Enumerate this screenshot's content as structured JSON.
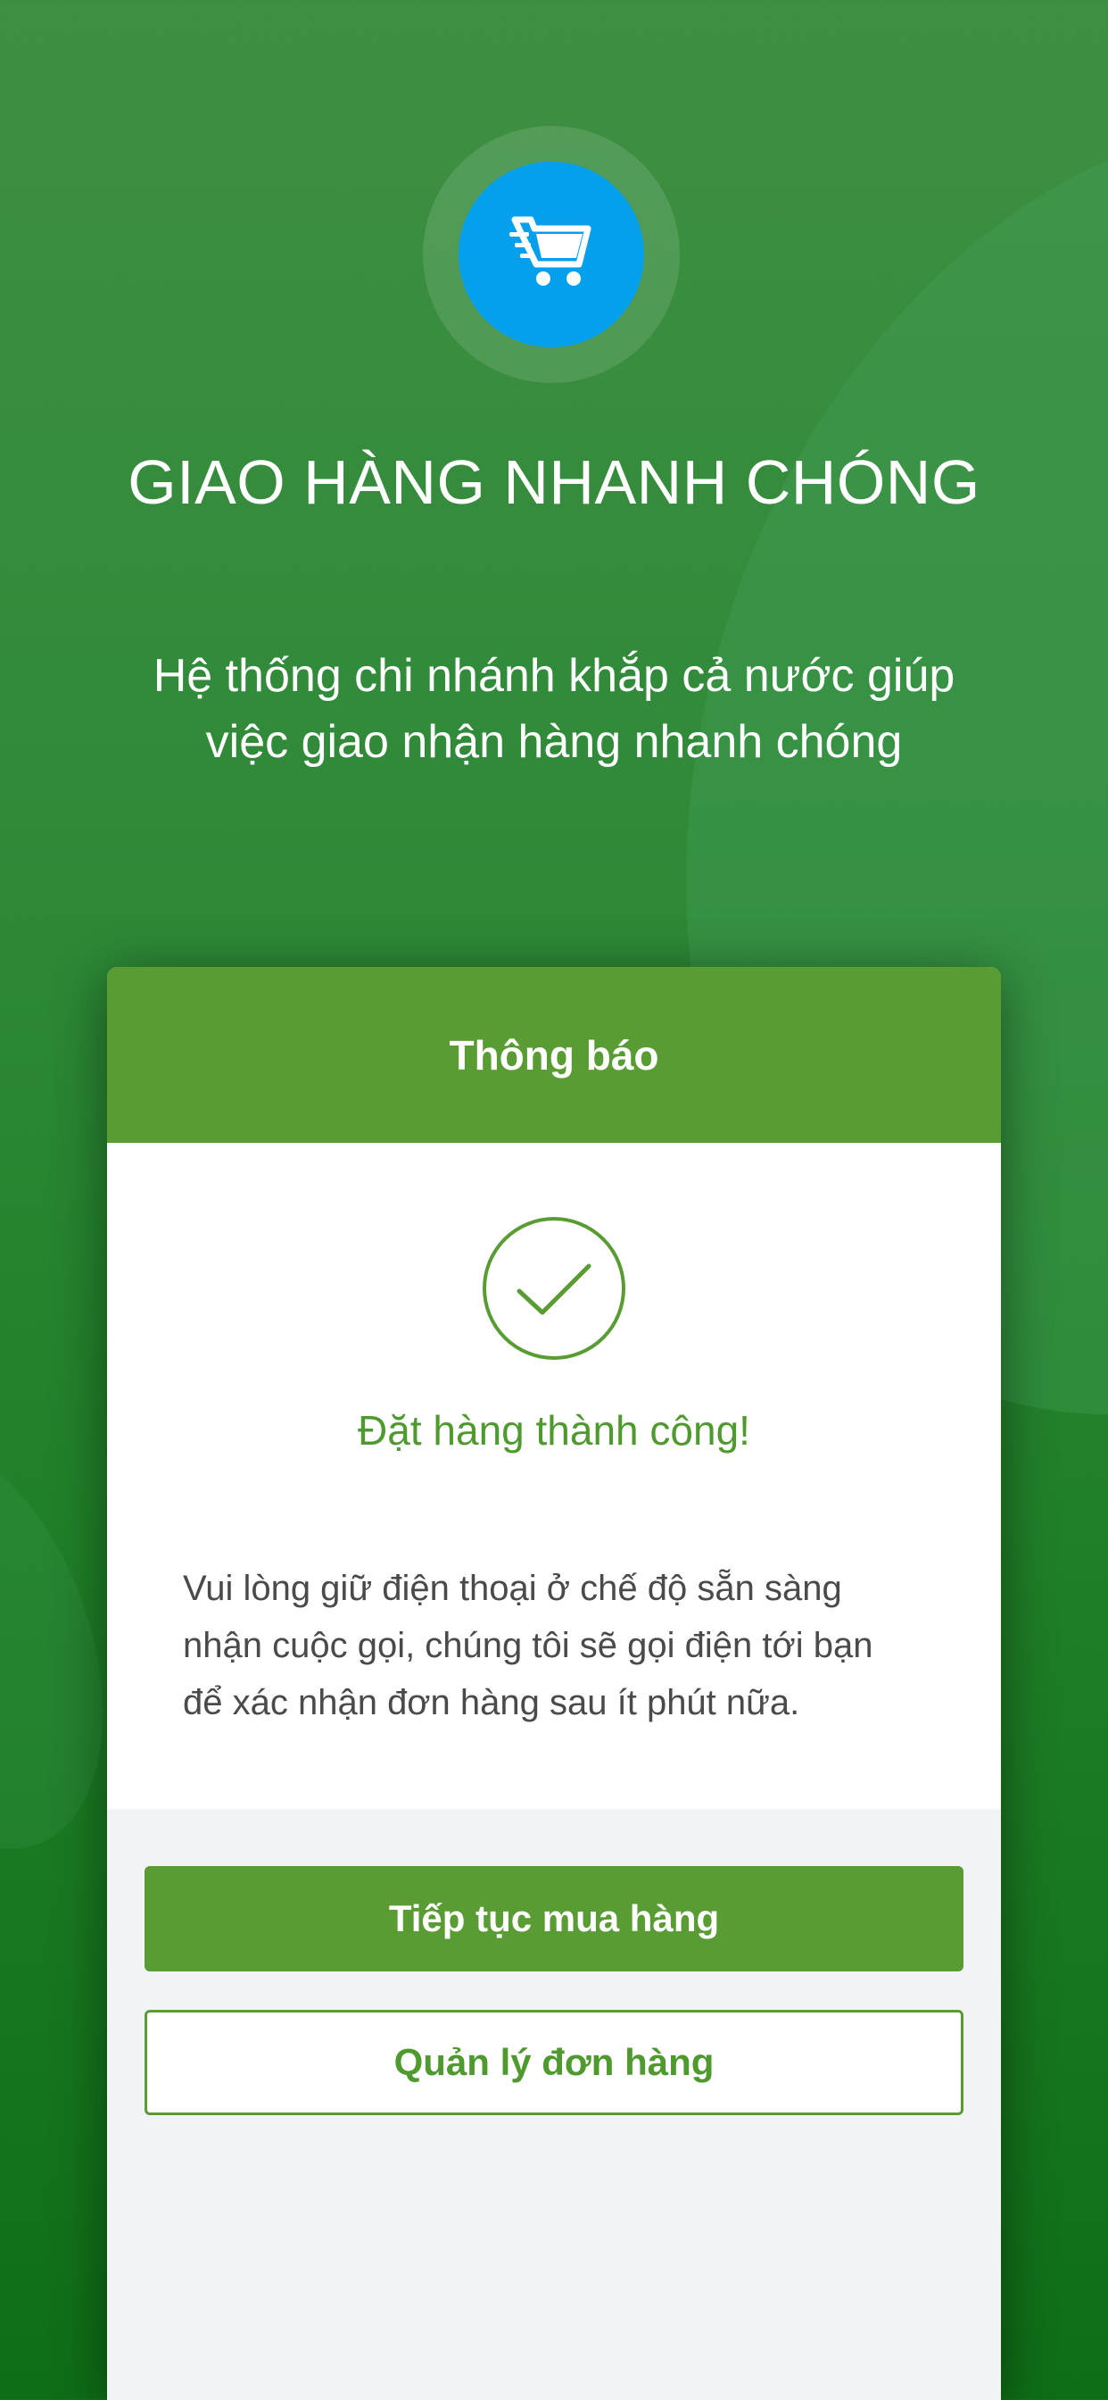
{
  "hero": {
    "icon": "shopping-cart-icon",
    "title": "GIAO HÀNG NHANH CHÓNG",
    "subtitle_line1": "Hệ thống chi nhánh khắp cả nước giúp",
    "subtitle_line2": "việc giao nhận hàng nhanh chóng"
  },
  "dialog": {
    "header_title": "Thông báo",
    "success_icon": "checkmark-circle-icon",
    "success_title": "Đặt hàng thành công!",
    "message_line1": "Vui lòng giữ điện thoại ở chế độ sẵn sàng",
    "message_line2": "nhận cuộc gọi, chúng tôi sẽ gọi điện tới bạn",
    "message_line3": "để xác nhận đơn hàng sau ít phút nữa.",
    "primary_button": "Tiếp tục mua hàng",
    "secondary_button": "Quản lý đơn hàng"
  },
  "colors": {
    "accent_green": "#5a9c34",
    "icon_blue": "#04a0eb",
    "background_green": "#2f8a38"
  }
}
